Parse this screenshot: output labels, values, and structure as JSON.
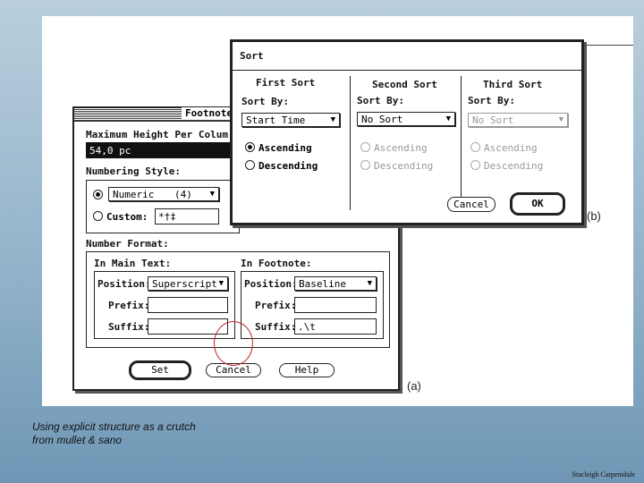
{
  "caption": {
    "line1": "Using explicit structure as a crutch",
    "line2": "from mullet & sano"
  },
  "credit": "Stacleigh Carpenidale",
  "footnote_dialog": {
    "title": "Footnote",
    "max_height_label": "Maximum Height Per Colum",
    "max_height_value": "54,0 pc",
    "numbering_style_label": "Numbering Style:",
    "numeric_option": "Numeric",
    "numeric_value": "(4)",
    "custom_label": "Custom:",
    "custom_value": "*†‡",
    "number_format_label": "Number Format:",
    "main_text": {
      "label": "In Main Text:",
      "position_label": "Position:",
      "position_value": "Superscript",
      "prefix_label": "Prefix:",
      "prefix_value": "",
      "suffix_label": "Suffix:",
      "suffix_value": ""
    },
    "in_footnote": {
      "label": "In Footnote:",
      "position_label": "Position:",
      "position_value": "Baseline",
      "prefix_label": "Prefix:",
      "prefix_value": "",
      "suffix_label": "Suffix:",
      "suffix_value": ".\\t"
    },
    "set_button": "Set",
    "cancel_button": "Cancel",
    "help_button": "Help",
    "figure_label": "(a)"
  },
  "sort_dialog": {
    "title": "Sort",
    "first_sort": {
      "heading": "First Sort",
      "sort_by_label": "Sort By:",
      "value": "Start Time",
      "ascending": "Ascending",
      "descending": "Descending"
    },
    "second_sort": {
      "heading": "Second Sort",
      "sort_by_label": "Sort By:",
      "value": "No Sort",
      "ascending": "Ascending",
      "descending": "Descending"
    },
    "third_sort": {
      "heading": "Third Sort",
      "sort_by_label": "Sort By:",
      "value": "No Sort",
      "ascending": "Ascending",
      "descending": "Descending"
    },
    "cancel_button": "Cancel",
    "ok_button": "OK",
    "figure_label": "(b)"
  }
}
